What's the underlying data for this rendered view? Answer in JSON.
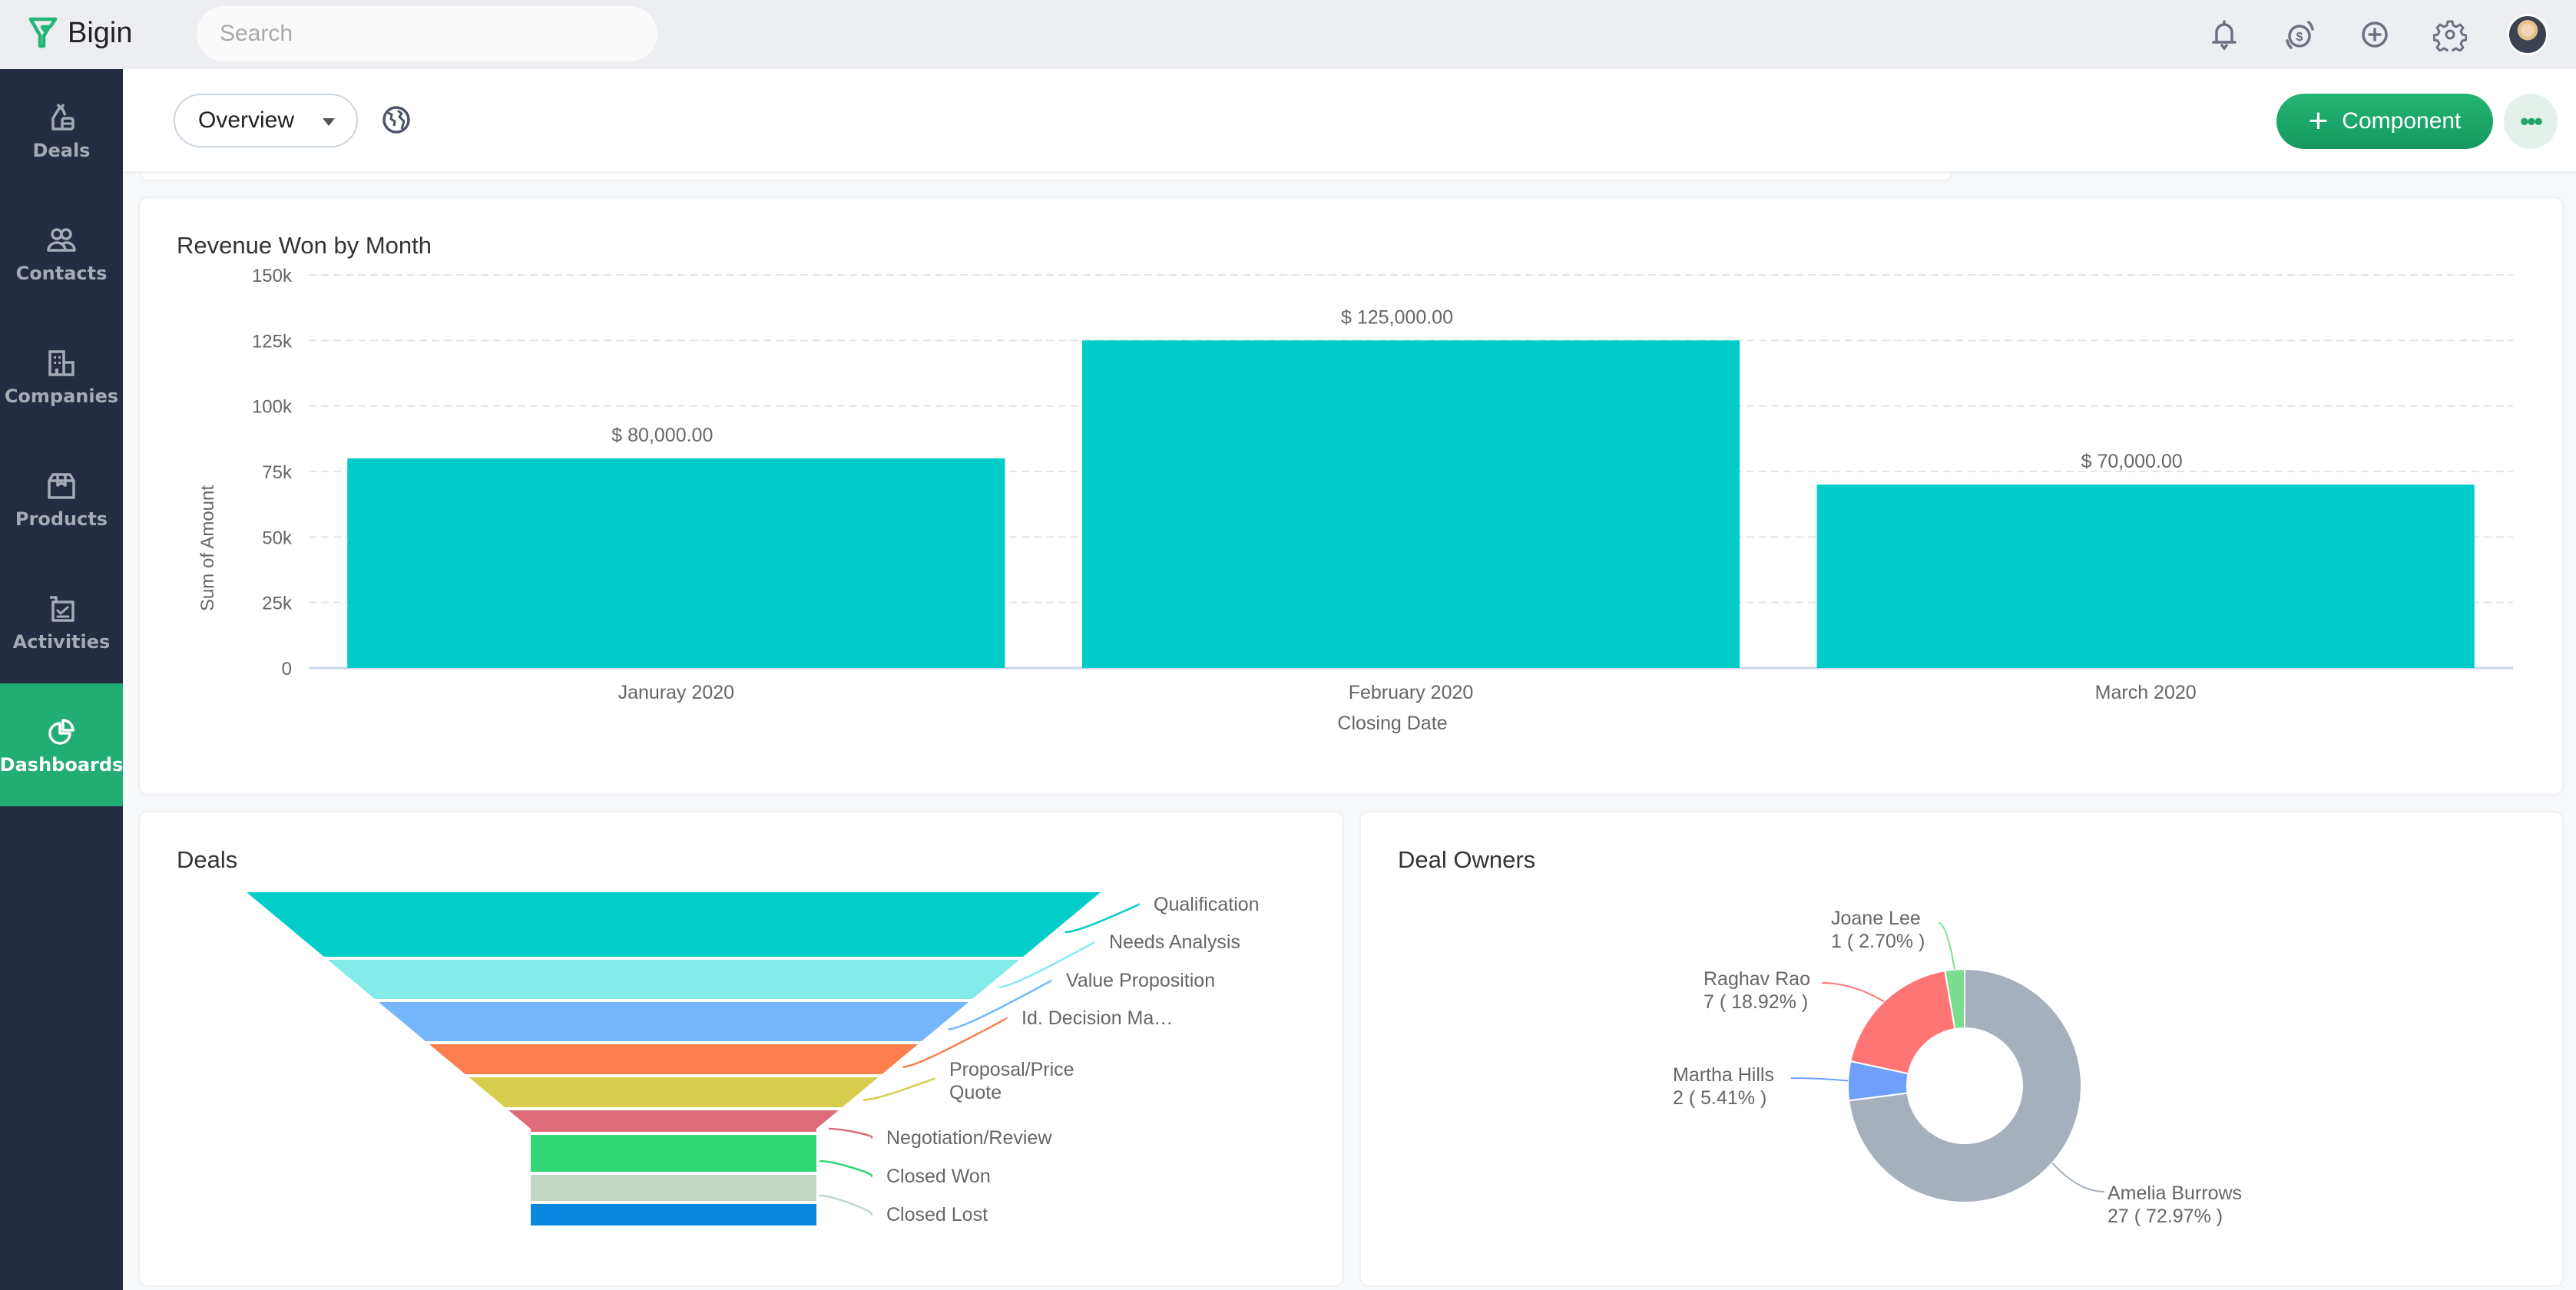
{
  "app": {
    "name": "Bigin"
  },
  "search": {
    "placeholder": "Search"
  },
  "topbar_icons": [
    {
      "name": "notifications-icon"
    },
    {
      "name": "pricing-icon"
    },
    {
      "name": "quick-create-icon"
    },
    {
      "name": "settings-icon"
    },
    {
      "name": "user-avatar"
    }
  ],
  "sidebar": {
    "items": [
      {
        "label": "Deals",
        "icon": "deals-bag-icon",
        "active": false
      },
      {
        "label": "Contacts",
        "icon": "contacts-icon",
        "active": false
      },
      {
        "label": "Companies",
        "icon": "companies-building-icon",
        "active": false
      },
      {
        "label": "Products",
        "icon": "products-box-icon",
        "active": false
      },
      {
        "label": "Activities",
        "icon": "activities-icon",
        "active": false
      },
      {
        "label": "Dashboards",
        "icon": "dashboards-pie-icon",
        "active": true
      }
    ]
  },
  "header": {
    "dashboard_select": "Overview",
    "add_component_label": "Component",
    "more_label": "•••"
  },
  "colors": {
    "brand_green": "#22ad74",
    "sidebar_bg": "#232c40",
    "bar_color": "#00cdc9"
  },
  "chart_data": [
    {
      "type": "bar",
      "title": "Revenue Won by Month",
      "xlabel": "Closing Date",
      "ylabel": "Sum of Amount",
      "categories": [
        "Januray 2020",
        "February 2020",
        "March 2020"
      ],
      "values": [
        80000,
        125000,
        70000
      ],
      "data_labels": [
        "$ 80,000.00",
        "$ 125,000.00",
        "$ 70,000.00"
      ],
      "ylim": [
        0,
        150000
      ],
      "yticks": [
        0,
        25000,
        50000,
        75000,
        100000,
        125000,
        150000
      ],
      "ytick_labels": [
        "0",
        "25k",
        "50k",
        "75k",
        "100k",
        "125k",
        "150k"
      ],
      "grid": true,
      "color": "#00cdc9"
    },
    {
      "type": "funnel",
      "title": "Deals",
      "stages": [
        {
          "label": "Qualification",
          "color": "#02cdc9"
        },
        {
          "label": "Needs Analysis",
          "color": "#83ecea"
        },
        {
          "label": "Value Proposition",
          "color": "#75b6fc"
        },
        {
          "label": "Id. Decision Ma...",
          "color": "#fe7e4d"
        },
        {
          "label": "Proposal/Price Quote",
          "color": "#d7cd4d"
        },
        {
          "label": "Negotiation/Review",
          "color": "#de6c79"
        },
        {
          "label": "Closed Won",
          "color": "#2fd775"
        },
        {
          "label": "Closed Lost",
          "color": "#c0d7c6"
        },
        {
          "label": "",
          "color": "#0a87e1"
        }
      ]
    },
    {
      "type": "pie",
      "title": "Deal Owners",
      "donut": true,
      "slices": [
        {
          "name": "Amelia Burrows",
          "value": 27,
          "percent": "72.97%",
          "color": "#a6b0bd"
        },
        {
          "name": "Martha Hills",
          "value": 2,
          "percent": "5.41%",
          "color": "#6fa0fc"
        },
        {
          "name": "Raghav Rao",
          "value": 7,
          "percent": "18.92%",
          "color": "#ff7575"
        },
        {
          "name": "Joane Lee",
          "value": 1,
          "percent": "2.70%",
          "color": "#7bdd8f"
        }
      ]
    }
  ]
}
